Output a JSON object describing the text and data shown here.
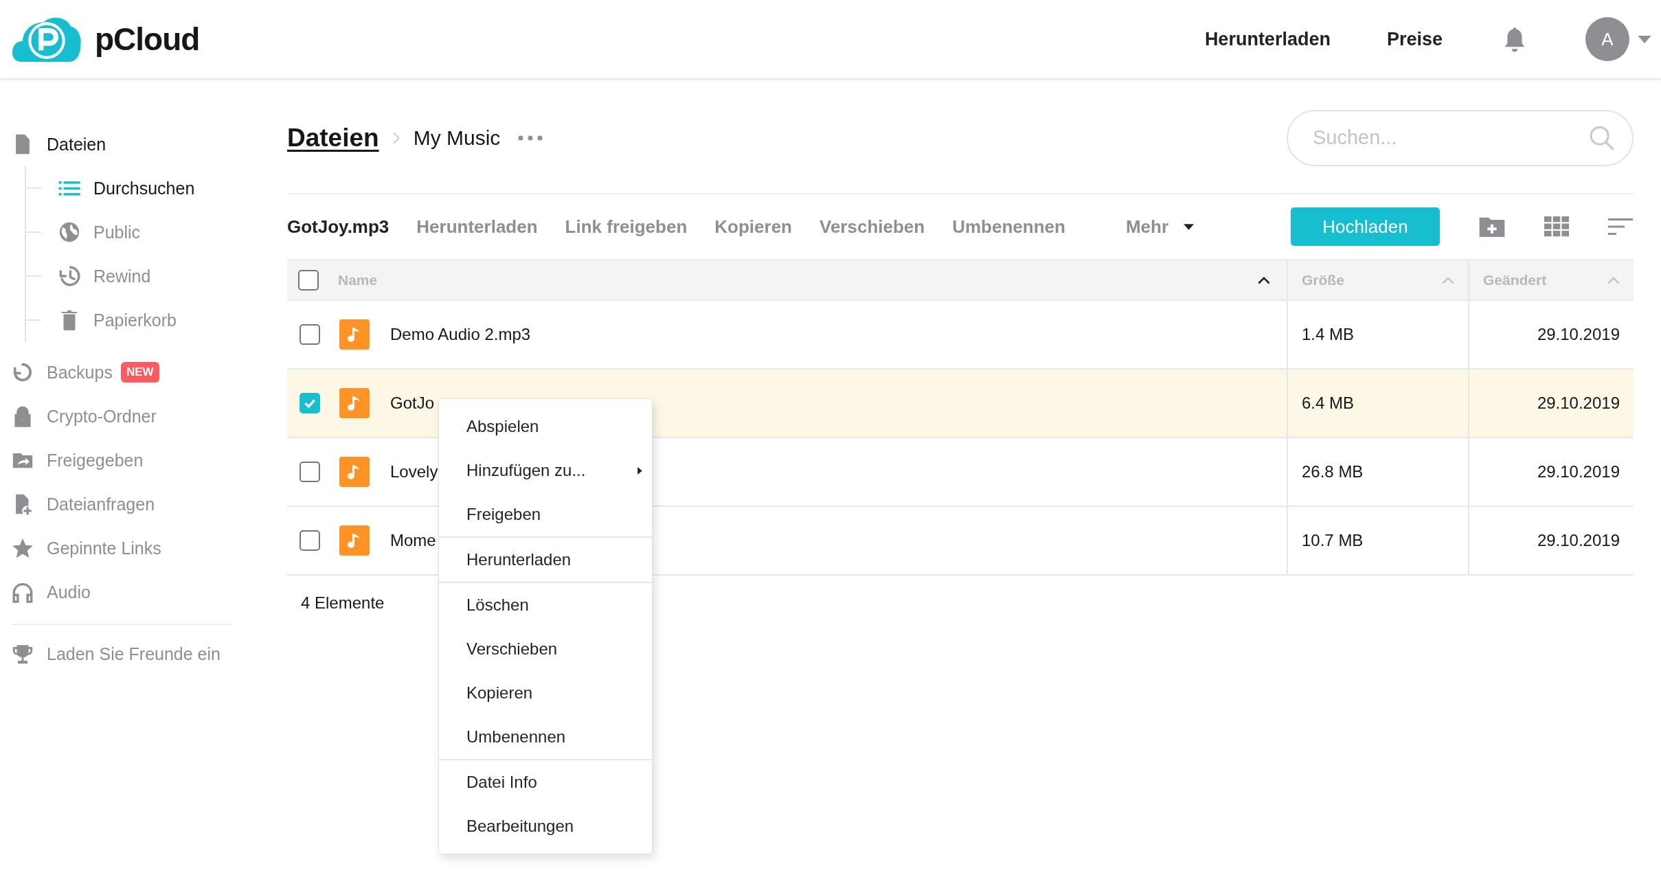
{
  "header": {
    "logo": "pCloud",
    "nav": [
      "Herunterladen",
      "Preise"
    ],
    "avatar": "A"
  },
  "sidebar": {
    "items": [
      {
        "label": "Dateien",
        "selected": true,
        "children": [
          {
            "label": "Durchsuchen",
            "selected": true
          },
          {
            "label": "Public",
            "selected": false
          },
          {
            "label": "Rewind",
            "selected": false
          },
          {
            "label": "Papierkorb",
            "selected": false
          }
        ]
      },
      {
        "label": "Backups",
        "selected": false,
        "badge": "NEW"
      },
      {
        "label": "Crypto-Ordner",
        "selected": false
      },
      {
        "label": "Freigegeben",
        "selected": false
      },
      {
        "label": "Dateianfragen",
        "selected": false
      },
      {
        "label": "Gepinnte Links",
        "selected": false
      },
      {
        "label": "Audio",
        "selected": false
      }
    ],
    "invite": "Laden Sie Freunde ein"
  },
  "breadcrumb": {
    "root": "Dateien",
    "current": "My Music"
  },
  "search": {
    "placeholder": "Suchen..."
  },
  "toolbar": {
    "selection": "GotJoy.mp3",
    "actions": [
      "Herunterladen",
      "Link freigeben",
      "Kopieren",
      "Verschieben",
      "Umbenennen"
    ],
    "more": "Mehr",
    "upload": "Hochladen"
  },
  "table": {
    "select_all": {
      "checked": false
    },
    "columns": [
      {
        "label": "Name",
        "sort_active": true
      },
      {
        "label": "Größe",
        "sort_active": false
      },
      {
        "label": "Geändert",
        "sort_active": false
      }
    ],
    "rows": [
      {
        "checked": false,
        "selected": false,
        "name": "Demo Audio 2.mp3",
        "size": "1.4 MB",
        "modified": "29.10.2019"
      },
      {
        "checked": true,
        "selected": true,
        "name": "GotJo",
        "size": "6.4 MB",
        "modified": "29.10.2019"
      },
      {
        "checked": false,
        "selected": false,
        "name": "Lovely",
        "size": "26.8 MB",
        "modified": "29.10.2019"
      },
      {
        "checked": false,
        "selected": false,
        "name": "Mome",
        "size": "10.7 MB",
        "modified": "29.10.2019"
      }
    ]
  },
  "footer": "4 Elemente",
  "context_menu": {
    "groups": [
      [
        {
          "label": "Abspielen",
          "submenu": false
        },
        {
          "label": "Hinzufügen zu...",
          "submenu": true
        },
        {
          "label": "Freigeben",
          "submenu": false
        }
      ],
      [
        {
          "label": "Herunterladen",
          "submenu": false
        }
      ],
      [
        {
          "label": "Löschen",
          "submenu": false
        },
        {
          "label": "Verschieben",
          "submenu": false
        },
        {
          "label": "Kopieren",
          "submenu": false
        },
        {
          "label": "Umbenennen",
          "submenu": false
        }
      ],
      [
        {
          "label": "Datei Info",
          "submenu": false
        },
        {
          "label": "Bearbeitungen",
          "submenu": false
        }
      ]
    ]
  }
}
